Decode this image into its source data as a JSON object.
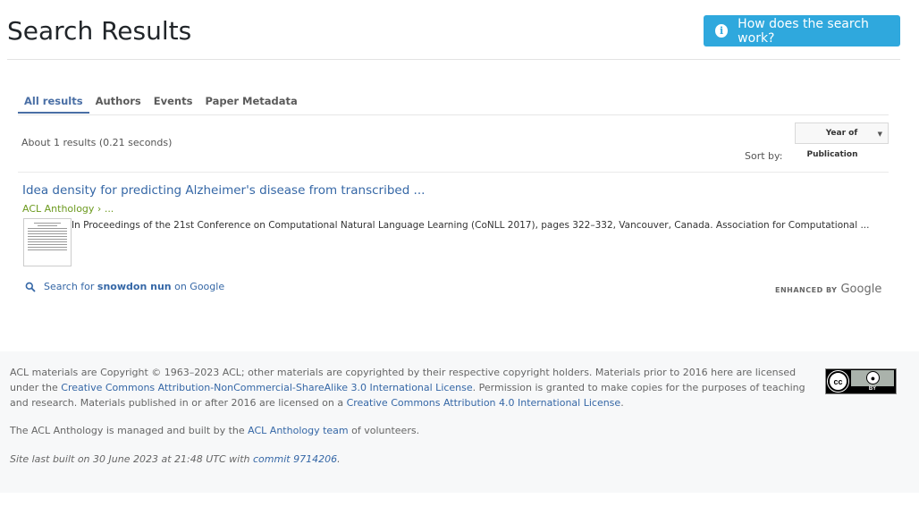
{
  "header": {
    "title": "Search Results",
    "help_button": "How does the search work?",
    "help_icon": "info-icon"
  },
  "tabs": [
    {
      "label": "All results",
      "active": true
    },
    {
      "label": "Authors",
      "active": false
    },
    {
      "label": "Events",
      "active": false
    },
    {
      "label": "Paper Metadata",
      "active": false
    }
  ],
  "results_info": {
    "count_text": "About 1 results (0.21 seconds)",
    "sort_label": "Sort by:",
    "sort_value_line1": "Year of",
    "sort_value_line2": "Publication"
  },
  "results": [
    {
      "title": "Idea density for predicting Alzheimer's disease from transcribed ...",
      "url": "ACL Anthology › ...",
      "snippet": "In Proceedings of the 21st Conference on Computational Natural Language Learning (CoNLL 2017), pages 322–332, Vancouver, Canada. Association for Computational ..."
    }
  ],
  "google_search": {
    "prefix": "Search for",
    "query": "snowdon nun",
    "suffix": "on Google",
    "enhanced_label": "ENHANCED BY",
    "enhanced_brand": "Google"
  },
  "footer": {
    "copyright_a": "ACL materials are Copyright © 1963–2023 ACL; other materials are copyrighted by their respective copyright holders. Materials prior to 2016 here are licensed under the ",
    "license1_link": "Creative Commons Attribution-NonCommercial-ShareAlike 3.0 International License",
    "copyright_b": ". Permission is granted to make copies for the purposes of teaching and research. Materials published in or after 2016 are licensed on a ",
    "license2_link": "Creative Commons Attribution 4.0 International License",
    "copyright_c": ".",
    "managed_a": "The ACL Anthology is managed and built by the ",
    "managed_link": "ACL Anthology team",
    "managed_b": " of volunteers.",
    "built_a": "Site last built on 30 June 2023 at 21:48 UTC with ",
    "built_link": "commit 9714206",
    "built_b": ".",
    "cc_badge_text": "cc",
    "cc_by_text": "BY"
  },
  "colors": {
    "accent": "#2fa8dd",
    "link": "#3567a6",
    "url_green": "#6c9a1f"
  }
}
